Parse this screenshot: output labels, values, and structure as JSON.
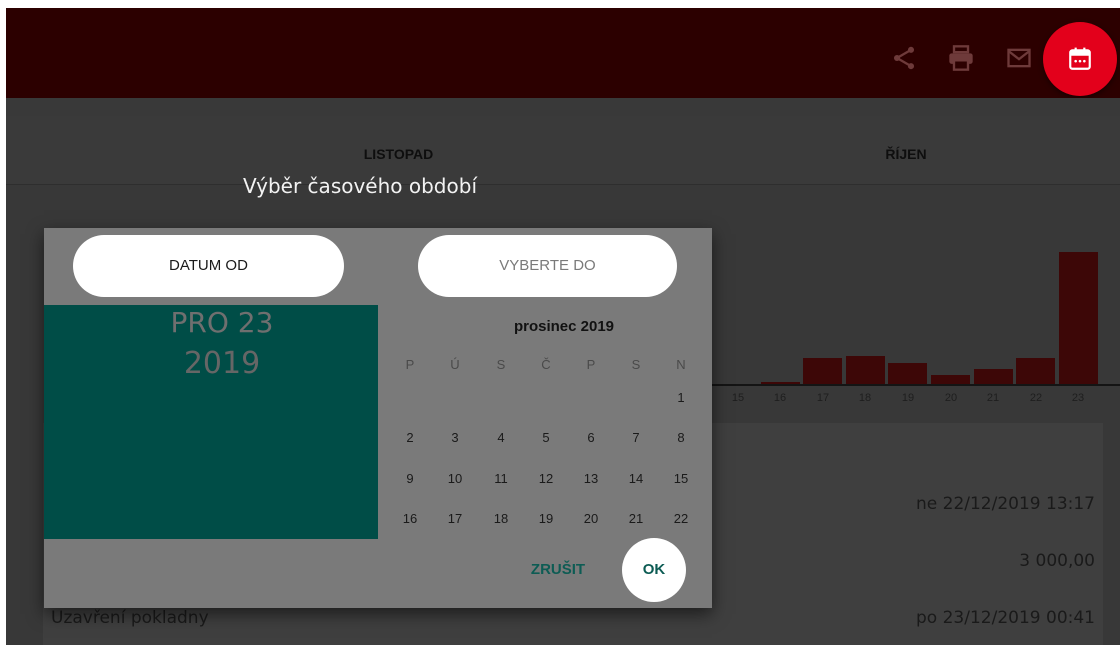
{
  "toolbar": {
    "icons": [
      "share-icon",
      "print-icon",
      "mail-icon"
    ],
    "fab_icon": "calendar-icon",
    "accent": "#e3001b"
  },
  "tabs": [
    {
      "label": "LISTOPAD"
    },
    {
      "label": "ŘÍJEN"
    }
  ],
  "chart_data": {
    "type": "bar",
    "categories": [
      "15",
      "16",
      "17",
      "18",
      "19",
      "20",
      "21",
      "22",
      "23"
    ],
    "values": [
      0,
      1,
      12,
      13,
      10,
      4,
      7,
      12,
      62
    ],
    "color": "#3d0707"
  },
  "rows": [
    {
      "value": "ne 22/12/2019 13:17"
    },
    {
      "value": "3 000,00"
    },
    {
      "label": "Uzavření pokladny",
      "value": "po 23/12/2019 00:41"
    }
  ],
  "dialog": {
    "title": "Výběr časového období",
    "from_label": "DATUM OD",
    "to_label": "VYBERTE DO",
    "selected_date": "PRO 23",
    "selected_year": "2019",
    "month_title": "prosinec 2019",
    "weekdays": [
      "P",
      "Ú",
      "S",
      "Č",
      "P",
      "S",
      "N"
    ],
    "weeks": [
      [
        "",
        "",
        "",
        "",
        "",
        "",
        "1"
      ],
      [
        "2",
        "3",
        "4",
        "5",
        "6",
        "7",
        "8"
      ],
      [
        "9",
        "10",
        "11",
        "12",
        "13",
        "14",
        "15"
      ],
      [
        "16",
        "17",
        "18",
        "19",
        "20",
        "21",
        "22"
      ]
    ],
    "cancel_label": "ZRUŠIT",
    "ok_label": "OK"
  }
}
